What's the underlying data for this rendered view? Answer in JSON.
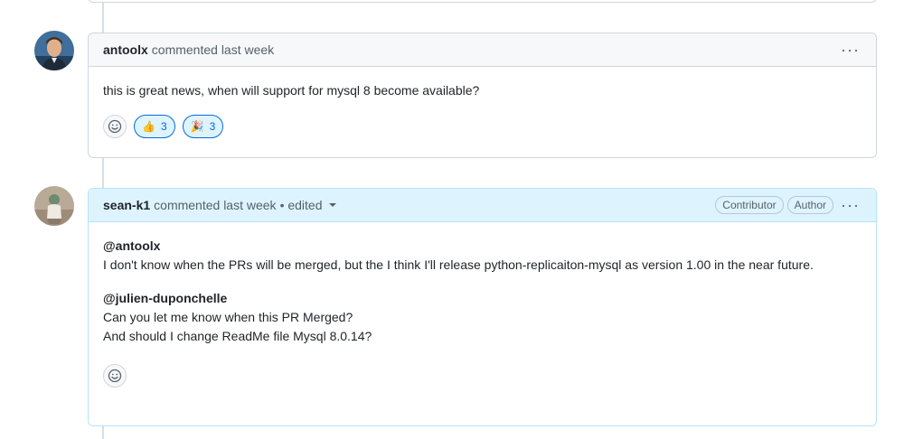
{
  "comments": [
    {
      "author": "antoolx",
      "meta": "commented last week",
      "body": "this is great news, when will support for mysql 8 become available?",
      "reactions": [
        {
          "emoji": "👍",
          "count": "3"
        },
        {
          "emoji": "🎉",
          "count": "3"
        }
      ]
    },
    {
      "author": "sean-k1",
      "meta": "commented last week",
      "edited": "• edited",
      "badges": [
        "Contributor",
        "Author"
      ],
      "paragraphs": [
        {
          "mention": "@antoolx",
          "text": "I don't know when the PRs will be merged, but the I think I'll release python-replicaiton-mysql as version 1.00 in the near future."
        },
        {
          "mention": "@julien-duponchelle",
          "line1": "Can you let me know when this PR Merged?",
          "line2": "And should I change ReadMe file Mysql 8.0.14?"
        }
      ]
    }
  ],
  "colors": {
    "accent": "#0969da",
    "highlight_header": "#ddf4ff",
    "border": "#d0d7de"
  }
}
